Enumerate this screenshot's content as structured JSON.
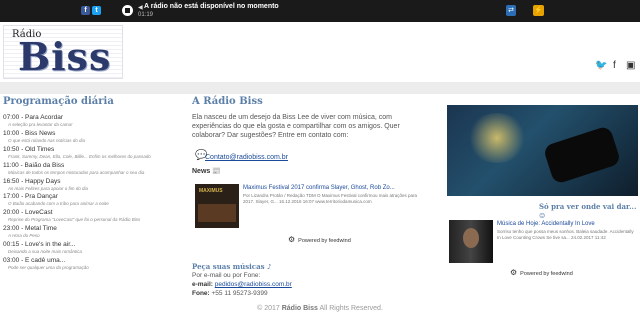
{
  "topbar": {
    "facebook_glyph": "f",
    "twitter_glyph": "t",
    "volume_glyph": "◀",
    "message": "A rádio não está disponível no momento",
    "time": "01:19",
    "right_icon_1": "⇄",
    "right_icon_2": "⚡",
    "icons": [
      "facebook-icon",
      "twitter-icon",
      "play-stop-icon",
      "volume-icon",
      "repeat-icon",
      "power-icon"
    ]
  },
  "header": {
    "logo_small": "Rádio",
    "logo_big": "Biss",
    "social_glyphs": [
      "🐦",
      "f",
      "▣"
    ]
  },
  "schedule": {
    "title": "Programação diária",
    "items": [
      {
        "title": "07:00 - Para Acordar",
        "sub": "A seleção pra levantar da cama!"
      },
      {
        "title": "10:00 - Biss News",
        "sub": "O que está rolando nas notícias do dia"
      },
      {
        "title": "10:50 - Old Times",
        "sub": "Frank, Sammy, Dean, Ella, Cole, Billie... Enfim os melhores do passado"
      },
      {
        "title": "11:00 - Baião da Biss",
        "sub": "Músicas de todos os tempos misturadas para acompanhar o seu dia"
      },
      {
        "title": "16:50 - Happy Days",
        "sub": "As mais Felizes para apoiar o fim do dia"
      },
      {
        "title": "17:00 - Pra Dançar",
        "sub": "O Baião acabando com a tribo para animar a noite"
      },
      {
        "title": "20:00 - LoveCast",
        "sub": "Reprise do Programa \"LoveCast\" que foi o personal da Rádio Biss"
      },
      {
        "title": "23:00 - Metal Time",
        "sub": "A Hora do Peso"
      },
      {
        "title": "00:15 - Love's in the air...",
        "sub": "Deixando a sua noite mais romântica"
      },
      {
        "title": "03:00 - E cadê uma...",
        "sub": "Pode ser qualquer uma da programação"
      }
    ]
  },
  "about": {
    "title": "A Rádio Biss",
    "text": "Ela nasceu de um desejo da Biss Lee de viver com música, com experiências do que ela gosta e compartilhar com os amigos. Quer colaborar? Dar sugestões? Entre em contato com:",
    "email": "Contato@radiobiss.com.br",
    "news_label": "News",
    "news_icon": "📰",
    "news_img_text": "MAXIMUS",
    "news_title": "Maximus Festival 2017 confirma Slayer, Ghost, Rob Zo...",
    "news_text": "Por Lizandra Protán / Redação TDM O Maximus Festival confirmou mais atrações para 2017. Slayer, G... 16.12.2016 16:07 www.territoriodamusica.com",
    "powered": "Powered by feedwind"
  },
  "orders": {
    "title": "Peça suas músicas",
    "note_icon": "♪",
    "line1": "Por e-mail ou por Fone:",
    "email_label": "e-mail:",
    "email": "pedidos@radiobiss.com.br",
    "phone_label": "Fone:",
    "phone": "+55 11 95273-9399"
  },
  "right": {
    "title": "Só pra ver onde vai dar...",
    "smile": "☺",
    "news_title": "Música de Hoje: Accidentally In Love",
    "news_text": "Sorriso tenho que possa meus sonhos. Baleia saudade. Accidentally In Love Counting Crows Se tive sa... 24.02.2017 11:42",
    "powered": "Powered by feedwind"
  },
  "footer": {
    "prefix": "© 2017",
    "brand": "Rádio Biss",
    "suffix": "All Rights Reserved."
  }
}
